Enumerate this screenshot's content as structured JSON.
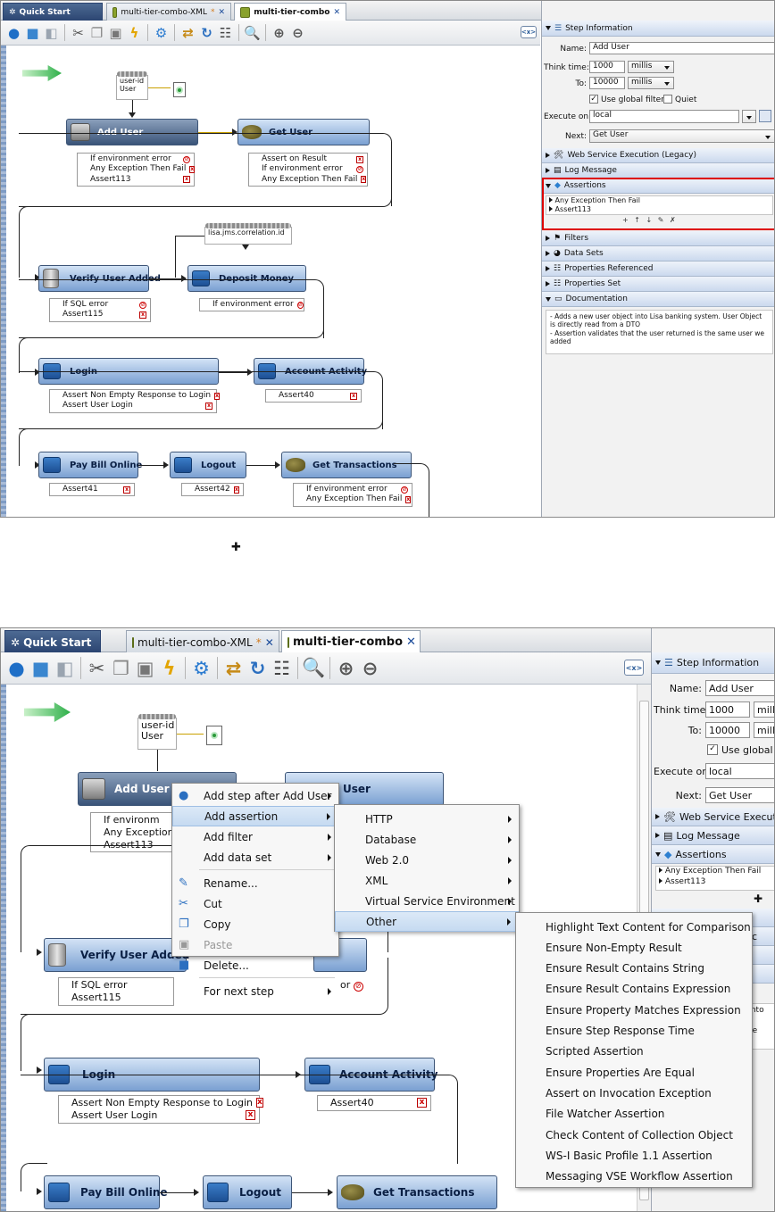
{
  "colors": {
    "accent": "#2c5d9a",
    "node_light": "#9cbbe3",
    "node_dark": "#3a5479",
    "highlight_box": "#d00000",
    "error_x": "#cc0000"
  },
  "tabs": {
    "quick_start": "Quick Start",
    "tab_xml": "multi-tier-combo-XML",
    "tab_active": "multi-tier-combo",
    "modified": "*",
    "close": "✕"
  },
  "toolbar_icons": [
    "add-step-icon",
    "delete-step-icon",
    "back-icon",
    "cut-icon",
    "copy-icon",
    "paste-icon",
    "lightning-icon",
    "gear-icon",
    "filter-icon",
    "refresh-icon",
    "list-icon",
    "zoom-icon",
    "zoom-in-icon",
    "zoom-out-icon"
  ],
  "canvas": {
    "start": {
      "prop_label": "user-id\nUser"
    },
    "prop2": "lisa.jms.correlation.id",
    "nodes": {
      "add_user": {
        "title": "Add User",
        "assertions": [
          "If environment error",
          "Any Exception Then Fail",
          "Assert113"
        ]
      },
      "get_user": {
        "title": "Get User",
        "assertions": [
          "Assert on Result",
          "If environment error",
          "Any Exception Then Fail"
        ]
      },
      "verify_user_added": {
        "title": "Verify User Added",
        "assertions": [
          "If SQL error",
          "Assert115"
        ]
      },
      "deposit_money": {
        "title": "Deposit Money",
        "assertions": [
          "If environment error"
        ]
      },
      "login": {
        "title": "Login",
        "assertions": [
          "Assert Non Empty Response to Login",
          "Assert User Login"
        ]
      },
      "account_activity": {
        "title": "Account Activity",
        "assertions": [
          "Assert40"
        ]
      },
      "pay_bill_online": {
        "title": "Pay Bill Online",
        "assertions": [
          "Assert41"
        ]
      },
      "logout": {
        "title": "Logout",
        "assertions": [
          "Assert42"
        ]
      },
      "get_transactions": {
        "title": "Get Transactions",
        "assertions": [
          "If environment error",
          "Any Exception Then Fail"
        ]
      }
    }
  },
  "step_info": {
    "header": "Step Information",
    "name_label": "Name:",
    "name_value": "Add User",
    "think_label": "Think time:",
    "think_value": "1000",
    "think_unit": "millis",
    "to_label": "To:",
    "to_value": "10000",
    "to_unit": "millis",
    "global_filters": "Use global filters",
    "quiet": "Quiet",
    "execute_label": "Execute on:",
    "execute_value": "local",
    "next_label": "Next:",
    "next_value": "Get User"
  },
  "sections": {
    "web_service": "Web Service Execution (Legacy)",
    "log_message": "Log Message",
    "assertions": "Assertions",
    "assertion_items": [
      "Any Exception Then Fail",
      "Assert113"
    ],
    "assertion_tools": "+ ↑ ↓ ✎ ✗",
    "filters": "Filters",
    "data_sets": "Data Sets",
    "props_ref": "Properties Referenced",
    "props_set": "Properties Set",
    "documentation": "Documentation",
    "doc_text": "- Adds a new user object into Lisa banking system. User Object is directly read from a DTO\n- Assertion validates that the user returned is the same user we added"
  },
  "plus_symbol": "✚",
  "shot2": {
    "partial_texts": {
      "get_user": "User",
      "env_err": "If environm",
      "any_ex": "Any Exception",
      "verify": "Verify User Added",
      "frag_or": "or",
      "ws_exec": "Web Service Executi",
      "millis": "millis",
      "global": "Use global fil",
      "doc1": "ct into",
      "doc2": "O",
      "doc3": "t the",
      "frag_renc": "renc"
    },
    "context_menu": [
      "Add step after Add User",
      "Add assertion",
      "Add filter",
      "Add data set",
      "Rename...",
      "Cut",
      "Copy",
      "Paste",
      "Delete...",
      "For next step"
    ],
    "assertion_submenu": [
      "HTTP",
      "Database",
      "Web 2.0",
      "XML",
      "Virtual Service Environment",
      "Other"
    ],
    "other_submenu": [
      "Highlight Text Content for Comparison",
      "Ensure Non-Empty Result",
      "Ensure Result Contains String",
      "Ensure Result Contains Expression",
      "Ensure Property Matches Expression",
      "Ensure Step Response Time",
      "Scripted Assertion",
      "Ensure Properties Are Equal",
      "Assert on Invocation Exception",
      "File Watcher Assertion",
      "Check Content of Collection Object",
      "WS-I Basic Profile 1.1 Assertion",
      "Messaging VSE Workflow Assertion"
    ]
  }
}
